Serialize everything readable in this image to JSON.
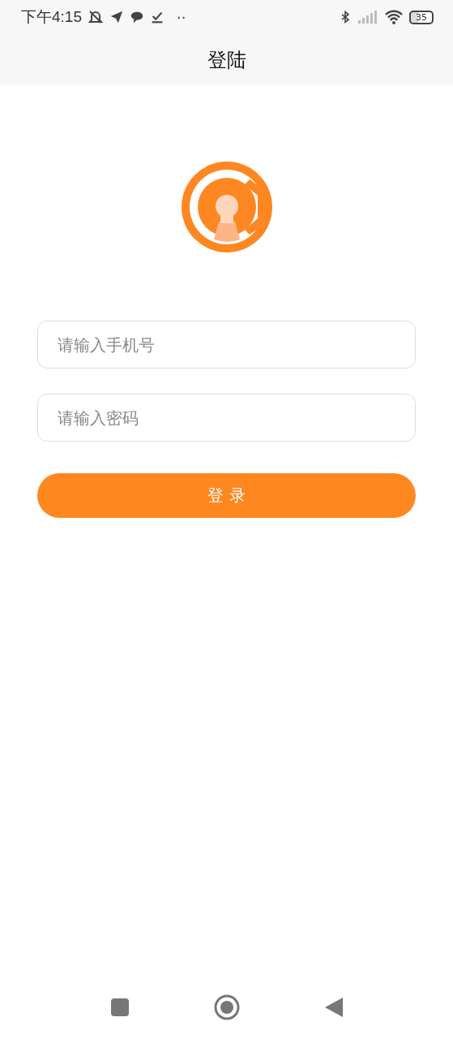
{
  "status_bar": {
    "time": "下午4:15",
    "dots": "··",
    "battery": "35"
  },
  "header": {
    "title": "登陆"
  },
  "form": {
    "fields": [
      {
        "placeholder": "请输入手机号"
      },
      {
        "placeholder": "请输入密码"
      }
    ],
    "submit": "登 录"
  }
}
